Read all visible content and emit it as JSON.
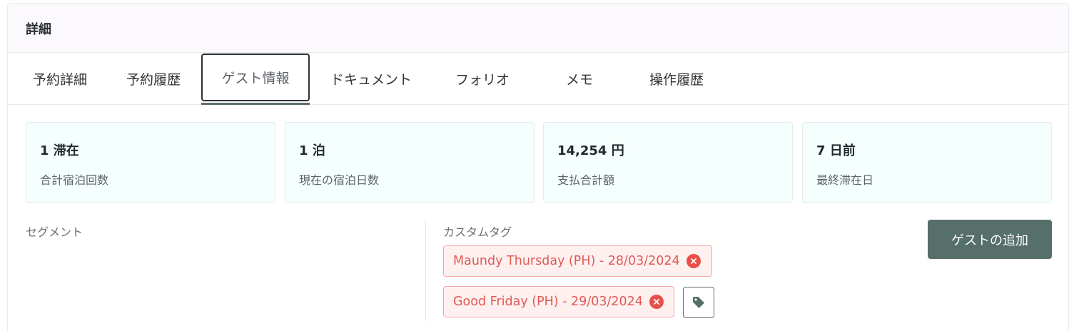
{
  "panel": {
    "title": "詳細"
  },
  "tabs": [
    {
      "label": "予約詳細",
      "active": false
    },
    {
      "label": "予約履歴",
      "active": false
    },
    {
      "label": "ゲスト情報",
      "active": true
    },
    {
      "label": "ドキュメント",
      "active": false
    },
    {
      "label": "フォリオ",
      "active": false
    },
    {
      "label": "メモ",
      "active": false
    },
    {
      "label": "操作履歴",
      "active": false
    }
  ],
  "stats": [
    {
      "value": "1 滞在",
      "label": "合計宿泊回数"
    },
    {
      "value": "1 泊",
      "label": "現在の宿泊日数"
    },
    {
      "value": "14,254 円",
      "label": "支払合計額"
    },
    {
      "value": "7 日前",
      "label": "最終滞在日"
    }
  ],
  "segment": {
    "label": "セグメント"
  },
  "custom_tags": {
    "label": "カスタムタグ",
    "tags": [
      {
        "text": "Maundy Thursday (PH) - 28/03/2024"
      },
      {
        "text": "Good Friday (PH) - 29/03/2024"
      }
    ]
  },
  "actions": {
    "add_guest": "ゲストの追加"
  },
  "colors": {
    "accent": "#566f6b",
    "tag_text": "#e05a55",
    "tag_bg": "#fff0f0",
    "tag_border": "#f2a8a6",
    "stat_bg": "#f5fffe"
  },
  "icons": {
    "tag_remove": "close-circle-icon",
    "tag_add": "tag-icon"
  }
}
